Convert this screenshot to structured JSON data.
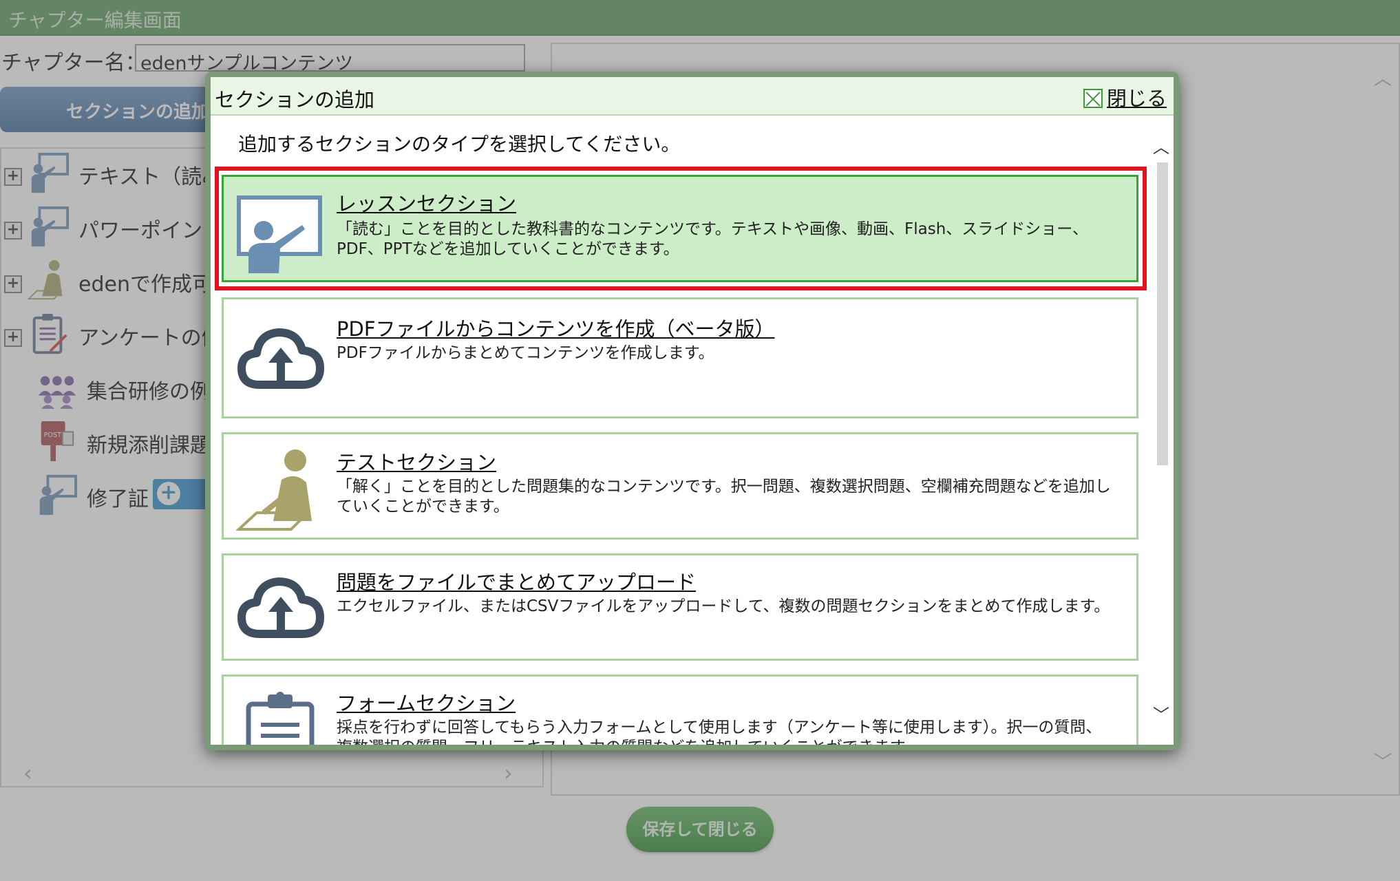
{
  "page": {
    "title": "チャプター編集画面",
    "chapter_name_label": "チャプター名：",
    "chapter_name_value": "edenサンプルコンテンツ",
    "add_section_button": "セクションの追加",
    "save_close_button": "保存して閉じる"
  },
  "tree": {
    "items": [
      {
        "label": "テキスト（読み",
        "icon": "lecturer-board-icon",
        "expandable": true
      },
      {
        "label": "パワーポイント",
        "icon": "lecturer-board-icon",
        "expandable": true
      },
      {
        "label": "edenで作成可能",
        "icon": "writing-person-icon",
        "expandable": true
      },
      {
        "label": "アンケートの例",
        "icon": "clipboard-icon",
        "expandable": true
      },
      {
        "label": "集合研修の例",
        "icon": "group-icon",
        "expandable": false
      },
      {
        "label": "新規添削課題",
        "icon": "post-box-icon",
        "expandable": false
      },
      {
        "label": "修了証",
        "icon": "lecturer-board-icon",
        "expandable": false
      }
    ]
  },
  "modal": {
    "title": "セクションの追加",
    "close_label": "閉じる",
    "instruction": "追加するセクションのタイプを選択してください。",
    "options": [
      {
        "title": "レッスンセクション",
        "description": "「読む」ことを目的とした教科書的なコンテンツです。テキストや画像、動画、Flash、スライドショー、PDF、PPTなどを追加していくことができます。",
        "icon": "lecturer-board-icon",
        "selected": true
      },
      {
        "title": "PDFファイルからコンテンツを作成（ベータ版）",
        "description": "PDFファイルからまとめてコンテンツを作成します。",
        "icon": "cloud-upload-icon",
        "selected": false
      },
      {
        "title": "テストセクション",
        "description": "「解く」ことを目的とした問題集的なコンテンツです。択一問題、複数選択問題、空欄補充問題などを追加していくことができます。",
        "icon": "writing-person-icon",
        "selected": false
      },
      {
        "title": "問題をファイルでまとめてアップロード",
        "description": "エクセルファイル、またはCSVファイルをアップロードして、複数の問題セクションをまとめて作成します。",
        "icon": "cloud-upload-icon",
        "selected": false
      },
      {
        "title": "フォームセクション",
        "description": "採点を行わずに回答してもらう入力フォームとして使用します（アンケート等に使用します）。択一の質問、複数選択の質問、フリーテキスト入力の質問などを追加していくことができます。",
        "icon": "clipboard-icon",
        "selected": false
      }
    ]
  },
  "colors": {
    "titlebar": "#5a9a5a",
    "selected_border": "#e0141e",
    "selected_bg": "#cdecc8",
    "option_border": "#a9d2a1",
    "icon_blue": "#6b8fb3",
    "icon_olive": "#a8a36a",
    "icon_dark": "#3f4f5f"
  }
}
